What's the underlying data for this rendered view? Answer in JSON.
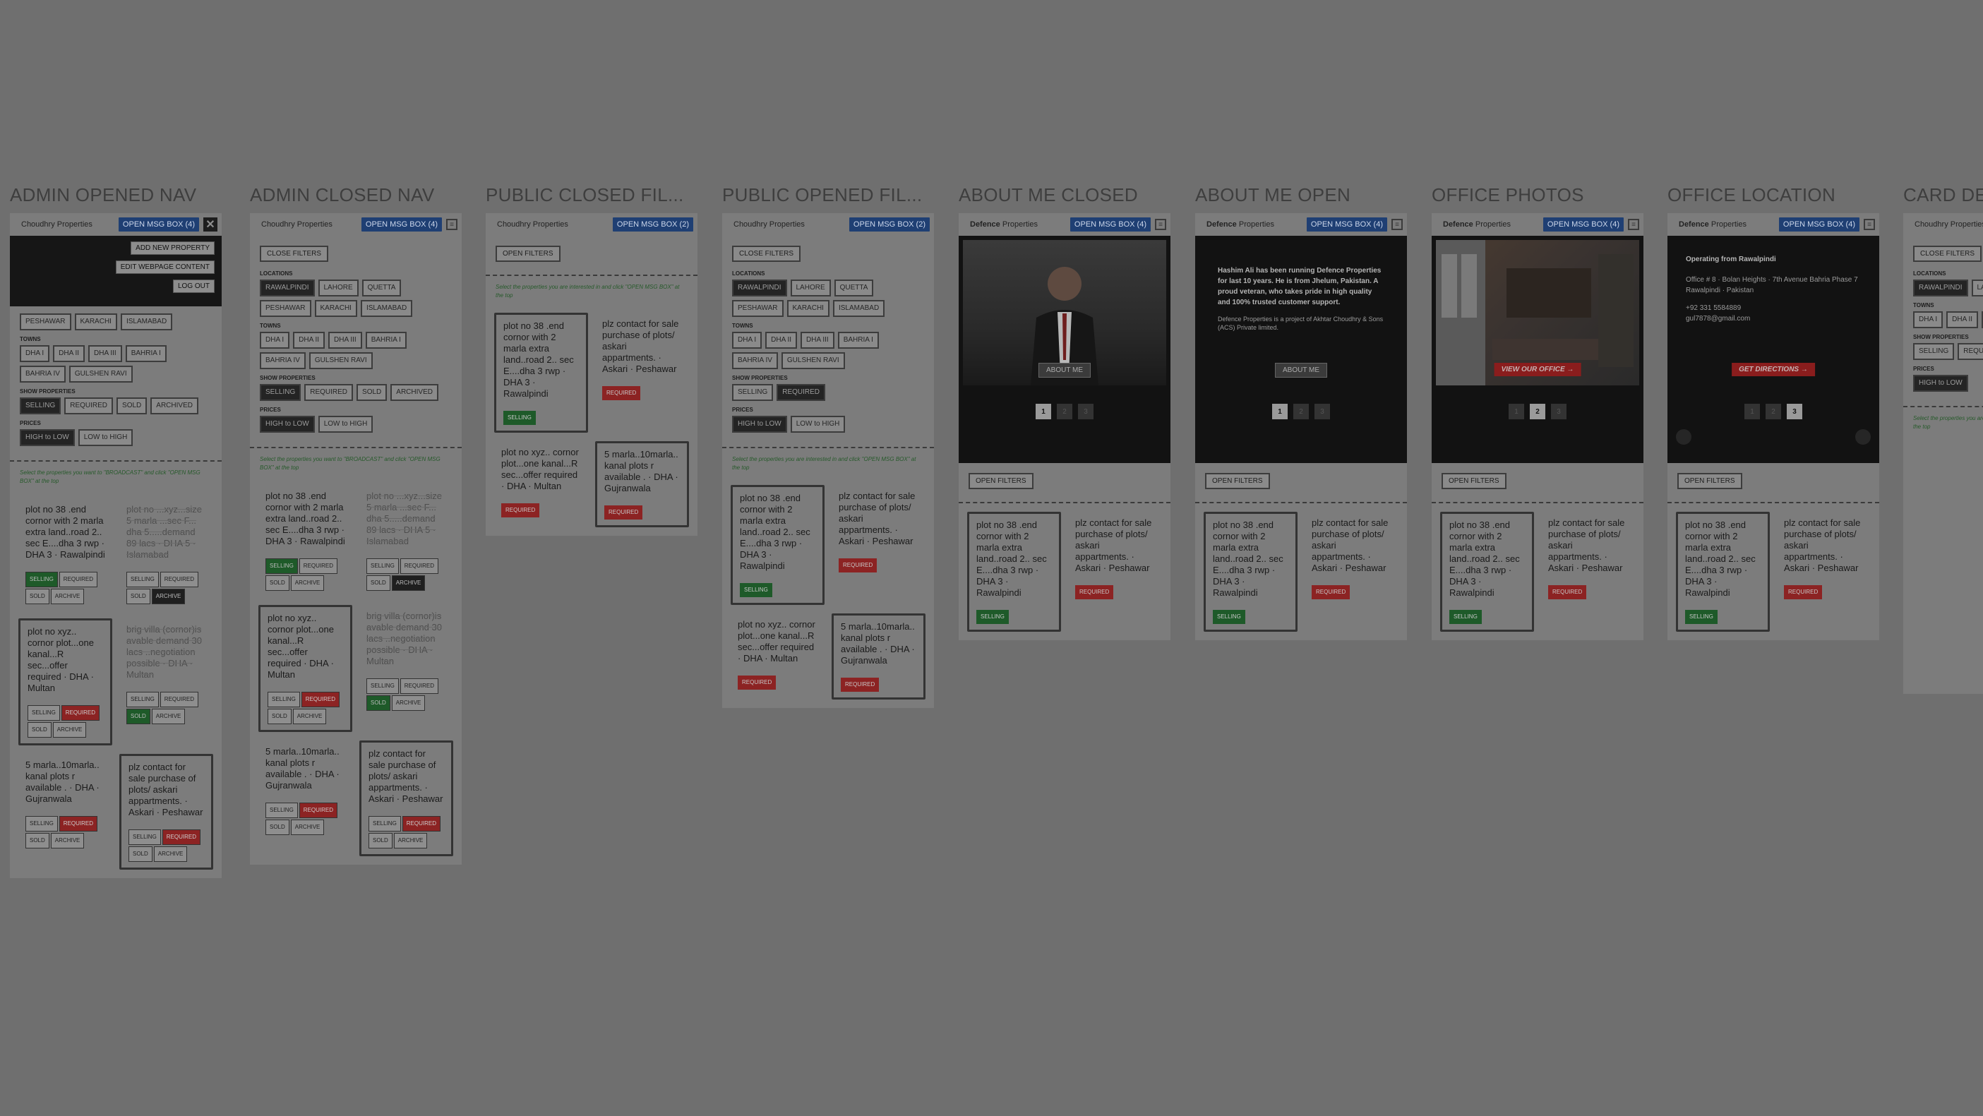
{
  "labels": {
    "brand_choudhry": "Choudhry Properties",
    "brand_defence_bold": "Defence",
    "brand_defence_rest": " Properties",
    "open_filters": "OPEN FILTERS",
    "close_filters": "CLOSE FILTERS",
    "locations": "LOCATIONS",
    "towns": "TOWNS",
    "show_properties": "SHOW PROPERTIES",
    "prices": "PRICES",
    "hint_admin": "Select the properties you want to \"BROADCAST\" and click \"OPEN MSG BOX\" at the top",
    "hint_public": "Select the properties you are interested in and click \"OPEN MSG BOX\" at the top"
  },
  "artboards": [
    {
      "title": "ADMIN OPENED NAV",
      "msg": "OPEN MSG BOX (4)"
    },
    {
      "title": "ADMIN CLOSED NAV",
      "msg": "OPEN MSG BOX (4)"
    },
    {
      "title": "PUBLIC CLOSED FIL...",
      "msg": "OPEN MSG BOX (2)"
    },
    {
      "title": "PUBLIC OPENED FIL...",
      "msg": "OPEN MSG BOX (2)"
    },
    {
      "title": "ABOUT ME CLOSED",
      "msg": "OPEN MSG BOX (4)"
    },
    {
      "title": "ABOUT ME OPEN",
      "msg": "OPEN MSG BOX (4)"
    },
    {
      "title": "OFFICE PHOTOS",
      "msg": "OPEN MSG BOX (4)"
    },
    {
      "title": "OFFICE LOCATION",
      "msg": "OPEN MSG BOX (4)"
    },
    {
      "title": "CARD DE",
      "msg": ""
    }
  ],
  "admin_menu": [
    "ADD NEW PROPERTY",
    "EDIT WEBPAGE CONTENT",
    "LOG OUT"
  ],
  "locations": [
    "RAWALPINDI",
    "LAHORE",
    "QUETTA",
    "PESHAWAR",
    "KARACHI",
    "ISLAMABAD"
  ],
  "towns": [
    "DHA I",
    "DHA II",
    "DHA III",
    "BAHRIA I",
    "BAHRIA IV",
    "GULSHEN RAVI"
  ],
  "show_admin": [
    "SELLING",
    "REQUIRED",
    "SOLD",
    "ARCHIVED"
  ],
  "show_public": [
    "SELLING",
    "REQUIRED"
  ],
  "prices": [
    "HIGH to LOW",
    "LOW to HIGH"
  ],
  "cards": {
    "c1": "plot no 38 .end cornor with 2 marla extra land..road 2.. sec E....dha 3 rwp · DHA 3 · Rawalpindi",
    "c2": "plot no ...xyz...size 5 marla ...sec F... dha 5.....demand 89 lacs · DHA 5 · Islamabad",
    "c3": "plot no xyz.. cornor plot...one kanal...R sec...offer required · DHA · Multan",
    "c4": "brig villa (cornor)is avable demand 30 lacs ..negotiation possible · DHA · Multan",
    "c5": "5 marla..10marla.. kanal plots r available . · DHA · Gujranwala",
    "c6": "plz contact for sale purchase of plots/ askari appartments. · Askari · Peshawar"
  },
  "tags": {
    "selling": "SELLING",
    "required": "REQUIRED",
    "sold": "SOLD",
    "archive": "ARCHIVE"
  },
  "about_closed_btn": "ABOUT ME",
  "about_open": {
    "text": "Hashim Ali has been running Defence Properties for last 10 years. He is from Jhelum, Pakistan. A proud veteran, who takes pride in high quality and 100% trusted customer support.",
    "subtext": "Defence Properties is a project of Akhtar Choudhry & Sons (ACS) Private limited.",
    "button": "ABOUT ME"
  },
  "office_photos_btn": "VIEW OUR OFFICE →",
  "office_location": {
    "title": "Operating from Rawalpindi",
    "address": "Office # 8 · Bolan Heights · 7th Avenue Bahria Phase 7 Rawalpindi · Pakistan",
    "phone": "+92 331 5584889",
    "email": "gul7878@gmail.com",
    "button": "GET DIRECTIONS →"
  },
  "pager": [
    "1",
    "2",
    "3"
  ]
}
